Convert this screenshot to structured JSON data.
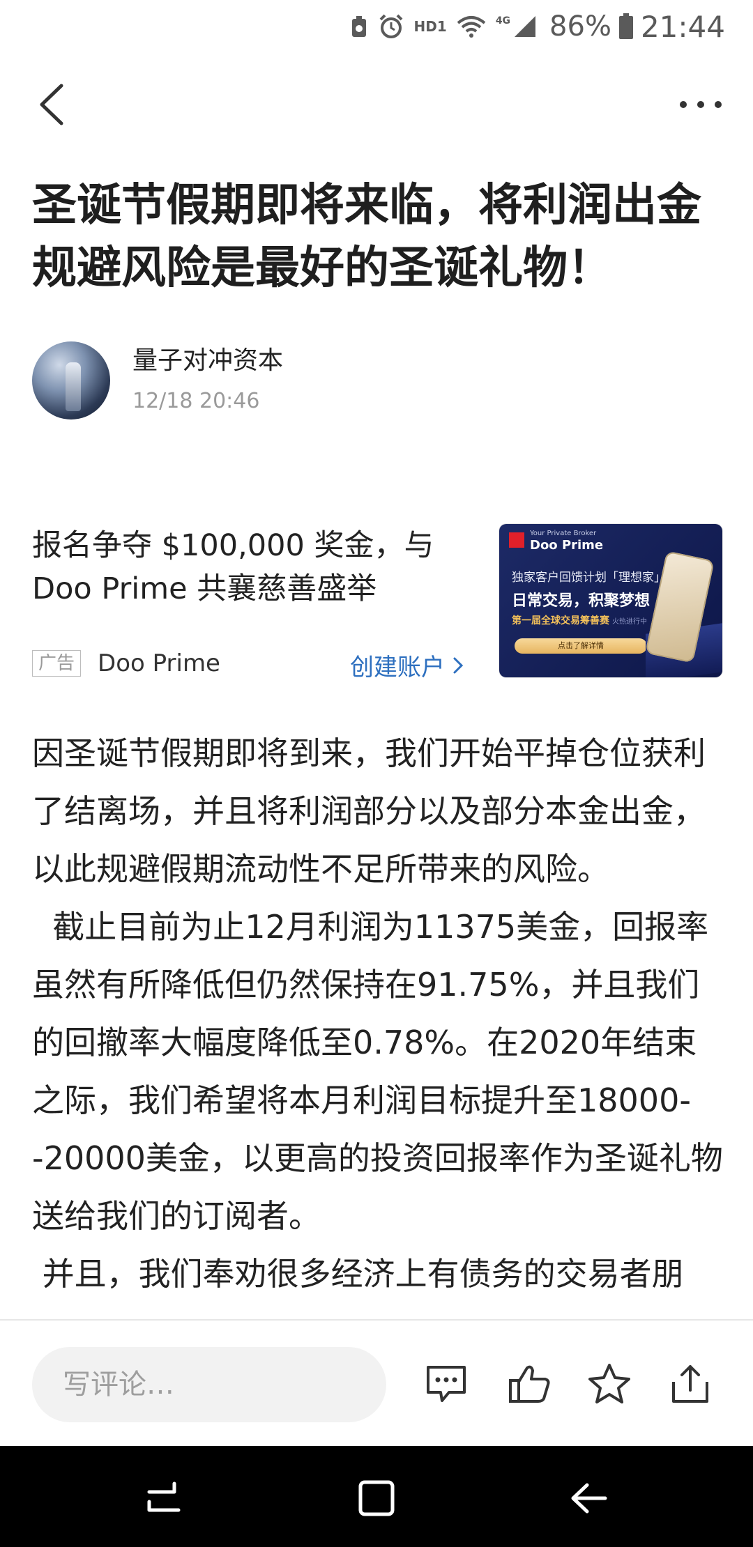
{
  "status_bar": {
    "network_label": "HD1",
    "signal_label": "4G",
    "battery_percent": "86%",
    "time": "21:44"
  },
  "nav": {
    "back_icon": "chevron-left-icon",
    "more_icon": "more-horizontal-icon"
  },
  "article": {
    "title": "圣诞节假期即将来临，将利润出金规避风险是最好的圣诞礼物！",
    "author": "量子对冲资本",
    "time": "12/18 20:46",
    "paragraphs": [
      "因圣诞节假期即将到来，我们开始平掉仓位获利了结离场，并且将利润部分以及部分本金出金，以此规避假期流动性不足所带来的风险。",
      "  截止目前为止12月利润为11375美金，回报率虽然有所降低但仍然保持在91.75%，并且我们的回撤率大幅度降低至0.78%。在2020年结束之际，我们希望将本月利润目标提升至18000--20000美金，以更高的投资回报率作为圣诞礼物送给我们的订阅者。",
      " 并且，我们奉劝很多经济上有债务的交易者朋"
    ]
  },
  "ad": {
    "title": "报名争夺 $100,000 奖金，与 Doo Prime 共襄慈善盛举",
    "label": "广告",
    "brand": "Doo Prime",
    "cta": "创建账户",
    "image": {
      "small_text": "Your Private Broker",
      "logo_text": "Doo Prime",
      "line1": "独家客户回馈计划「理想家」",
      "line2": "日常交易，积聚梦想",
      "line3": "第一届全球交易筹善赛",
      "line3_suffix": "火热进行中",
      "button": "点击了解详情"
    }
  },
  "bottom_bar": {
    "comment_placeholder": "写评论…",
    "comment_icon": "comment-icon",
    "like_icon": "thumbs-up-icon",
    "favorite_icon": "star-icon",
    "share_icon": "share-icon"
  },
  "colors": {
    "accent_link": "#2d6fbf",
    "text": "#222222",
    "muted": "#9a9a9a"
  }
}
